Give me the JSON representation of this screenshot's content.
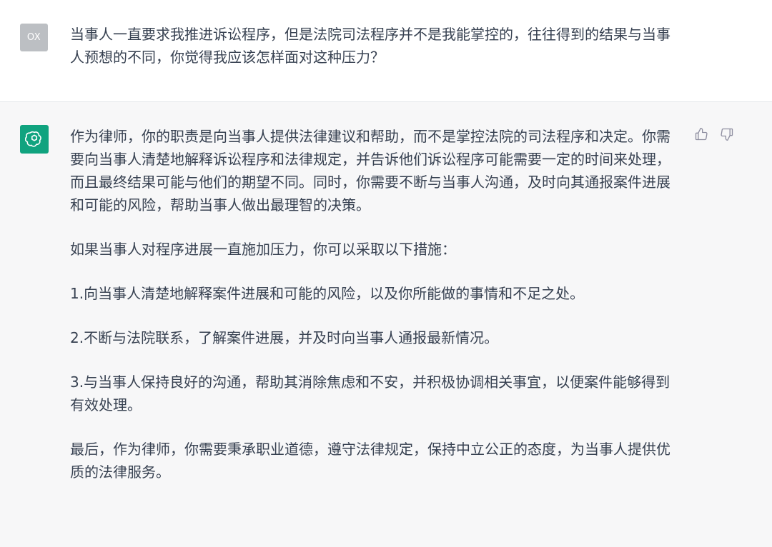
{
  "user_message": {
    "avatar_text": "OX",
    "text": "当事人一直要求我推进诉讼程序，但是法院司法程序并不是我能掌控的，往往得到的结果与当事人预想的不同，你觉得我应该怎样面对这种压力？"
  },
  "assistant_message": {
    "avatar_icon": "openai-logo-icon",
    "paragraphs": [
      "作为律师，你的职责是向当事人提供法律建议和帮助，而不是掌控法院的司法程序和决定。你需要向当事人清楚地解释诉讼程序和法律规定，并告诉他们诉讼程序可能需要一定的时间来处理，而且最终结果可能与他们的期望不同。同时，你需要不断与当事人沟通，及时向其通报案件进展和可能的风险，帮助当事人做出最理智的决策。",
      "如果当事人对程序进展一直施加压力，你可以采取以下措施：",
      "1.向当事人清楚地解释案件进展和可能的风险，以及你所能做的事情和不足之处。",
      "2.不断与法院联系，了解案件进展，并及时向当事人通报最新情况。",
      "3.与当事人保持良好的沟通，帮助其消除焦虑和不安，并积极协调相关事宜，以便案件能够得到有效处理。",
      "最后，作为律师，你需要秉承职业道德，遵守法律规定，保持中立公正的态度，为当事人提供优质的法律服务。"
    ],
    "feedback": {
      "thumbs_up_icon": "thumbs-up-icon",
      "thumbs_down_icon": "thumbs-down-icon"
    }
  },
  "colors": {
    "assistant_bg": "#f7f7f8",
    "user_avatar_bg": "#bcbfc3",
    "bot_avatar_bg": "#10a37f",
    "text": "#374151",
    "icon": "#8e8ea0"
  }
}
